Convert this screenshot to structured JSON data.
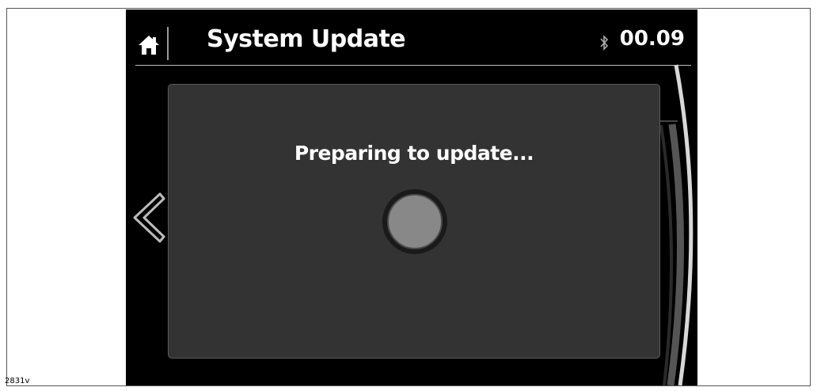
{
  "header": {
    "title": "System Update",
    "clock": "00.09",
    "home_icon": "home-icon",
    "bluetooth_icon": "bluetooth-icon"
  },
  "dialog": {
    "message": "Preparing to update...",
    "spinner_icon": "spinner-icon"
  },
  "nav": {
    "back_icon": "chevron-left-icon"
  },
  "caption": "2831v",
  "colors": {
    "screen_bg": "#000000",
    "panel_bg": "#333333",
    "spinner_fill": "#888888",
    "text": "#ffffff"
  }
}
